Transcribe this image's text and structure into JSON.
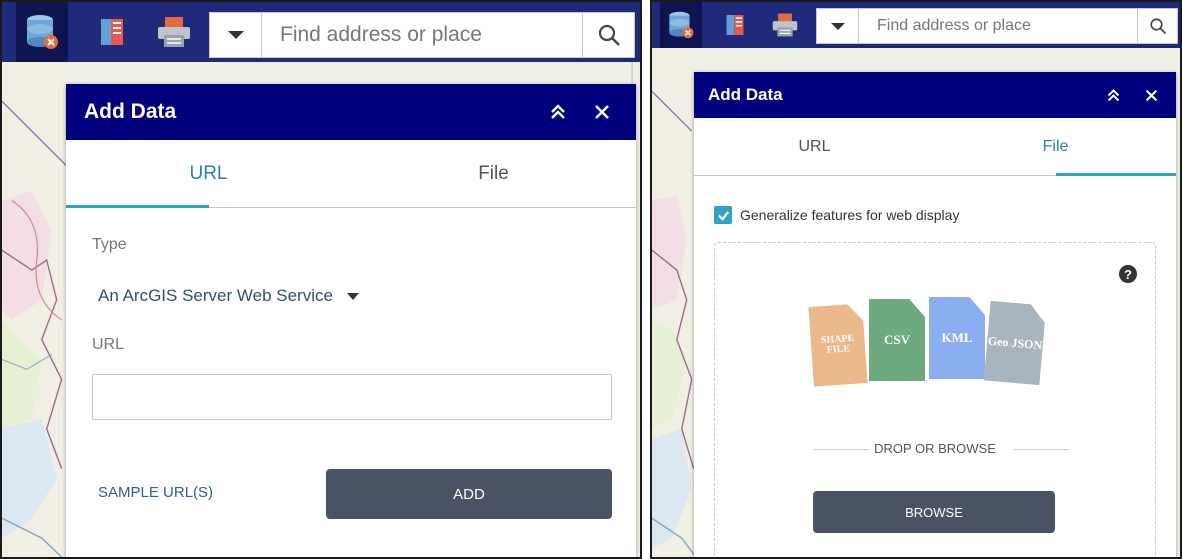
{
  "colors": {
    "toolbar": "#1f2b7a",
    "header": "#00007f",
    "accent": "#2fa0c6",
    "button": "#4a5363"
  },
  "search": {
    "placeholder": "Find address or place"
  },
  "toolbar_icons": [
    "add-data-icon",
    "bookmark-icon",
    "print-icon"
  ],
  "left": {
    "panel": {
      "title": "Add Data",
      "tabs": [
        {
          "label": "URL",
          "active": true
        },
        {
          "label": "File",
          "active": false
        }
      ],
      "type_label": "Type",
      "type_value": "An ArcGIS Server Web Service",
      "url_label": "URL",
      "url_value": "",
      "sample_link": "SAMPLE URL(S)",
      "add_button": "ADD"
    }
  },
  "right": {
    "panel": {
      "title": "Add Data",
      "tabs": [
        {
          "label": "URL",
          "active": false
        },
        {
          "label": "File",
          "active": true
        }
      ],
      "generalize_label": "Generalize features for web display",
      "generalize_checked": true,
      "file_types": [
        {
          "label": "SHAPE FILE",
          "color": "#eab88a"
        },
        {
          "label": "CSV",
          "color": "#6fa97f"
        },
        {
          "label": "KML",
          "color": "#8aaef0"
        },
        {
          "label": "Geo JSON",
          "color": "#a9b5be"
        }
      ],
      "drop_text": "DROP OR BROWSE",
      "browse_button": "BROWSE"
    }
  }
}
